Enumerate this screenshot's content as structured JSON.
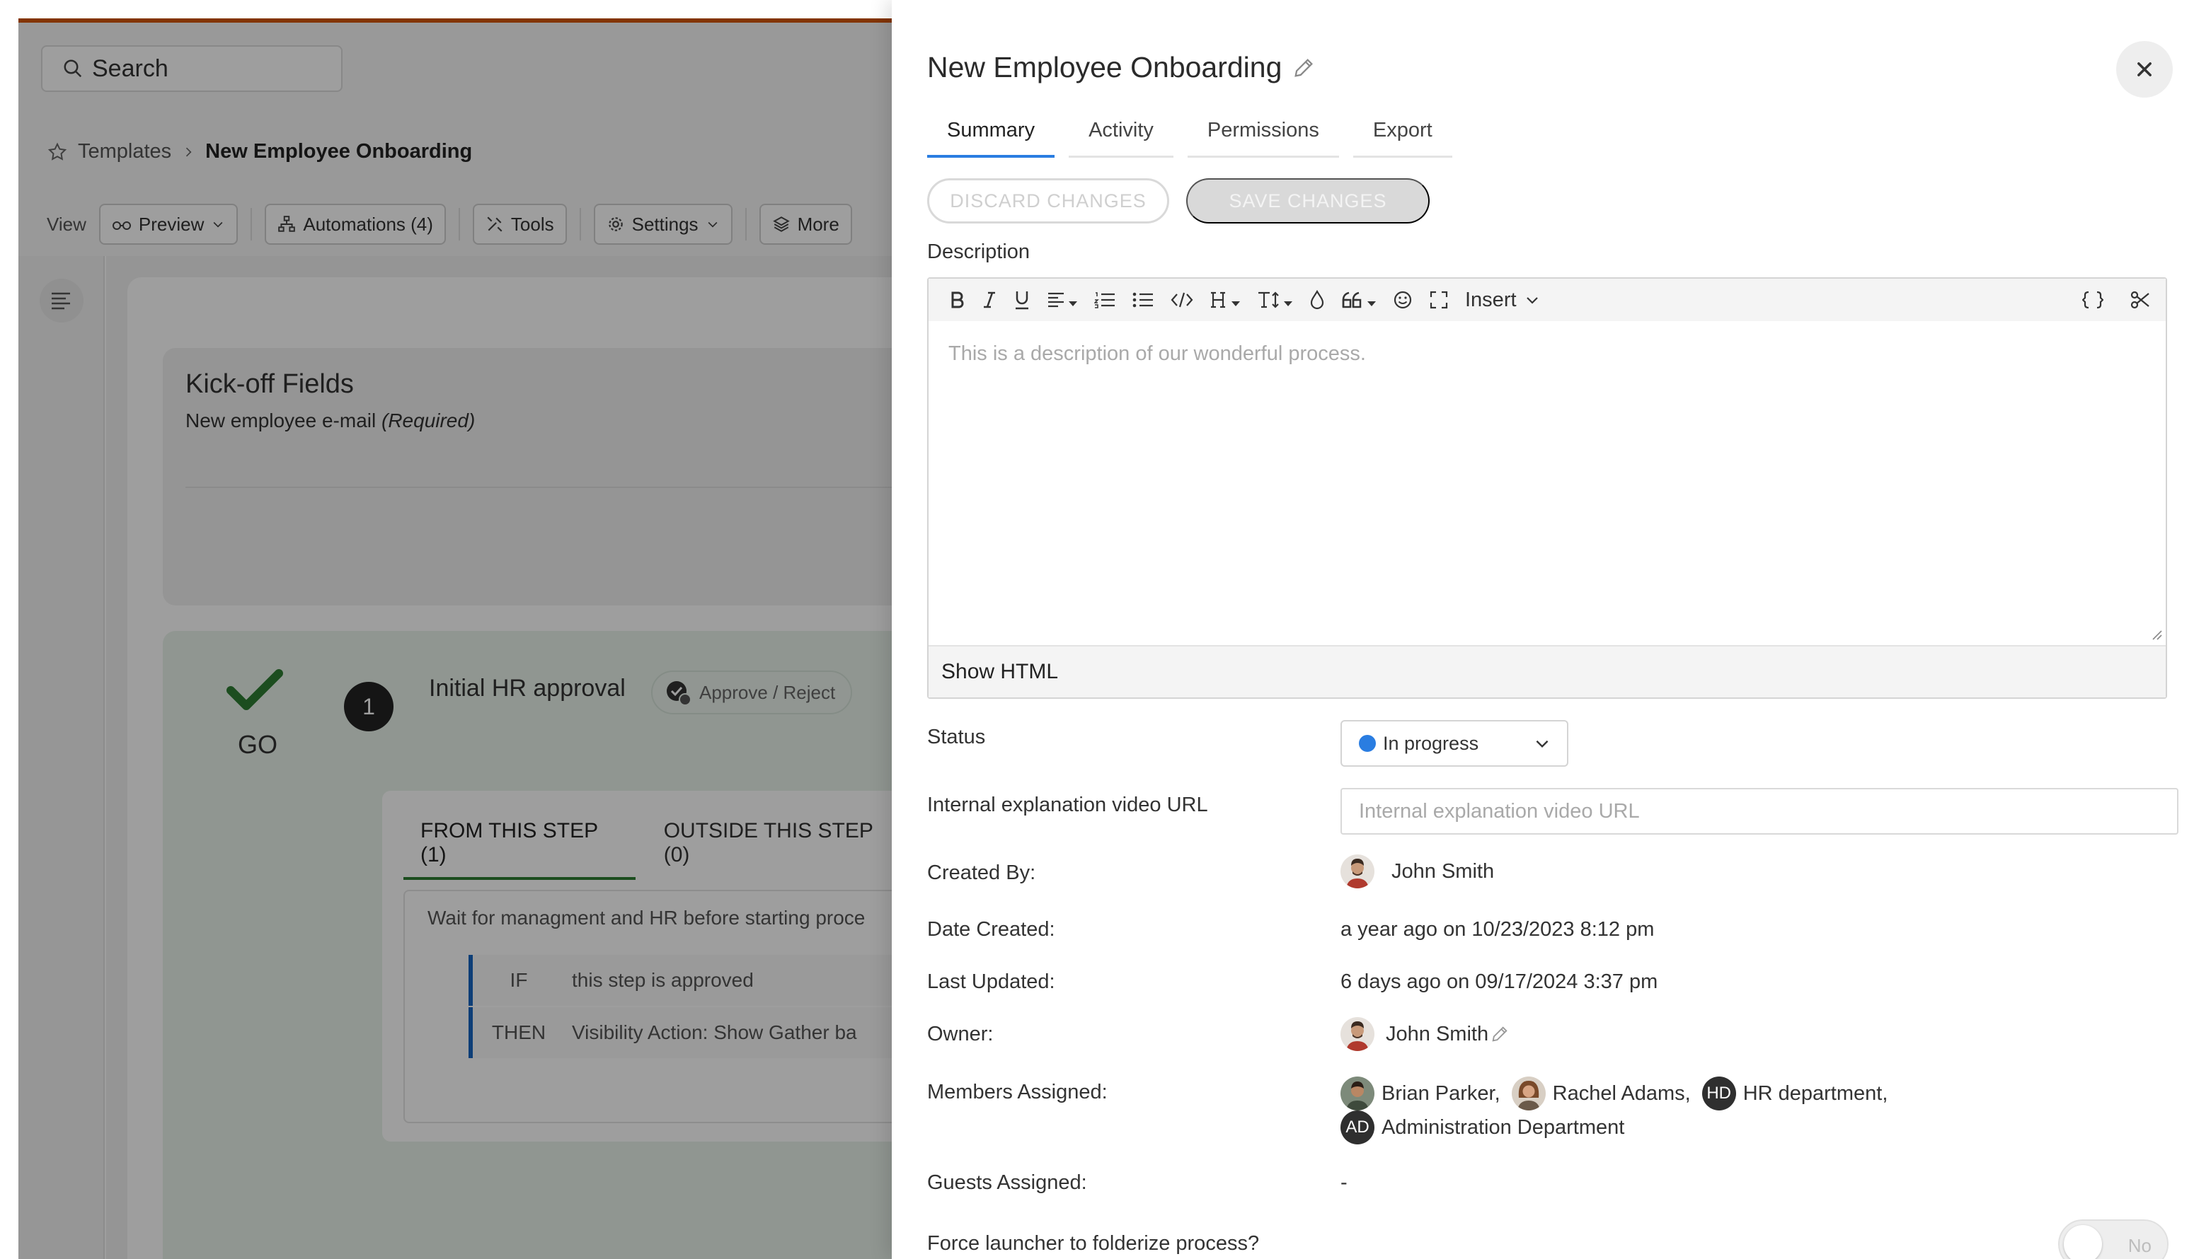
{
  "background_app": {
    "search_placeholder": "Search",
    "breadcrumb": {
      "root": "Templates",
      "current": "New Employee Onboarding"
    },
    "toolbar": {
      "view_label": "View",
      "preview": "Preview",
      "automations": "Automations (4)",
      "tools": "Tools",
      "settings": "Settings",
      "more": "More"
    },
    "kickoff": {
      "title": "Kick-off Fields",
      "field": "New employee e-mail",
      "required": "(Required)"
    },
    "step": {
      "go_label": "GO",
      "number": "1",
      "title": "Initial HR approval",
      "approve_chip": "Approve / Reject",
      "tabs": {
        "from": "FROM THIS STEP (1)",
        "outside": "OUTSIDE THIS STEP (0)"
      },
      "condition_description": "Wait for managment and HR before starting proce",
      "if_label": "IF",
      "if_value": "this step is approved",
      "then_label": "THEN",
      "then_value": "Visibility Action: Show Gather ba"
    }
  },
  "drawer": {
    "title": "New Employee Onboarding",
    "tabs": [
      "Summary",
      "Activity",
      "Permissions",
      "Export"
    ],
    "active_tab": "Summary",
    "discard_label": "DISCARD CHANGES",
    "save_label": "SAVE CHANGES",
    "description_label": "Description",
    "editor": {
      "insert_label": "Insert",
      "placeholder": "This is a description of our wonderful process.",
      "show_html": "Show HTML"
    },
    "fields": {
      "status_label": "Status",
      "status_value": "In progress",
      "status_color": "#2a7de1",
      "video_label": "Internal explanation video URL",
      "video_placeholder": "Internal explanation video URL",
      "video_value": "",
      "created_by_label": "Created By:",
      "created_by": "John Smith",
      "date_created_label": "Date Created:",
      "date_created": "a year ago on 10/23/2023 8:12 pm",
      "last_updated_label": "Last Updated:",
      "last_updated": "6 days ago on 09/17/2024 3:37 pm",
      "owner_label": "Owner:",
      "owner": "John Smith",
      "members_label": "Members Assigned:",
      "members": [
        {
          "name": "Brian Parker,",
          "initials": ""
        },
        {
          "name": "Rachel Adams,",
          "initials": ""
        },
        {
          "name": "HR department,",
          "initials": "HD"
        },
        {
          "name": "Administration Department",
          "initials": "AD"
        }
      ],
      "guests_label": "Guests Assigned:",
      "guests_value": "-",
      "folderize_label": "Force launcher to folderize process?",
      "folderize_value": "No"
    }
  },
  "colors": {
    "accent": "#2a7de1",
    "go_green": "#2e7d32",
    "brand_orange": "#d35400"
  }
}
